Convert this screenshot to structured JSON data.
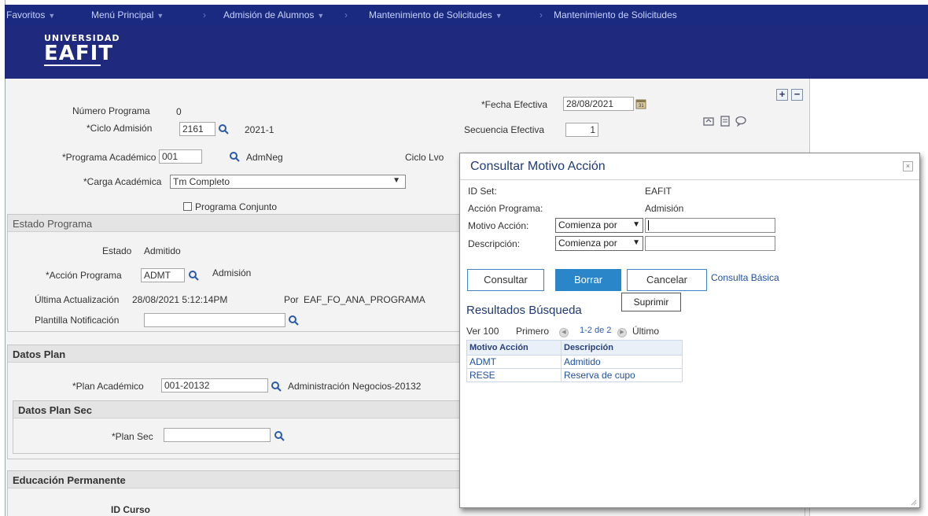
{
  "topnav": {
    "favoritos": "Favoritos",
    "menu": "Menú Principal",
    "crumb1": "Admisión de Alumnos",
    "crumb2": "Mantenimiento de Solicitudes",
    "crumb3": "Mantenimiento de Solicitudes"
  },
  "logo": {
    "line1": "UNIVERSIDAD",
    "line2": "EAFIT"
  },
  "form": {
    "numero_programa_label": "Número Programa",
    "numero_programa_value": "0",
    "ciclo_label": "*Ciclo Admisión",
    "ciclo_value": "2161",
    "ciclo_desc": "2021-1",
    "programa_label": "*Programa Académico",
    "programa_value": "001",
    "programa_desc": "AdmNeg",
    "ciclo_lvo_label": "Ciclo Lvo",
    "carga_label": "*Carga Académica",
    "carga_value": "Tm Completo",
    "programa_conjunto_label": "Programa Conjunto",
    "fecha_label": "*Fecha Efectiva",
    "fecha_value": "28/08/2021",
    "secuencia_label": "Secuencia Efectiva",
    "secuencia_value": "1"
  },
  "estado": {
    "title": "Estado Programa",
    "estado_label": "Estado",
    "estado_value": "Admitido",
    "accion_label": "*Acción Programa",
    "accion_value": "ADMT",
    "accion_desc": "Admisión",
    "ultima_label": "Última Actualización",
    "ultima_value": "28/08/2021  5:12:14PM",
    "por_label": "Por",
    "por_value": "EAF_FO_ANA_PROGRAMA",
    "plantilla_label": "Plantilla Notificación"
  },
  "plan": {
    "title": "Datos Plan",
    "plan_label": "*Plan Académico",
    "plan_value": "001-20132",
    "plan_desc": "Administración Negocios-20132",
    "sec_title": "Datos Plan Sec",
    "plan_sec_label": "*Plan Sec"
  },
  "educacion": {
    "title": "Educación Permanente",
    "id_curso_label": "ID Curso"
  },
  "modal": {
    "title": "Consultar Motivo Acción",
    "close": "×",
    "idset_label": "ID Set:",
    "idset_value": "EAFIT",
    "accion_label": "Acción Programa:",
    "accion_value": "Admisión",
    "motivo_label": "Motivo Acción:",
    "motivo_op": "Comienza por",
    "desc_label": "Descripción:",
    "desc_op": "Comienza por",
    "btn_consultar": "Consultar",
    "btn_borrar": "Borrar",
    "btn_cancelar": "Cancelar",
    "link_basica": "Consulta Básica",
    "tooltip": "Suprimir",
    "results_title": "Resultados Búsqueda",
    "pager_ver": "Ver 100",
    "pager_primero": "Primero",
    "pager_range": "1-2 de 2",
    "pager_ultimo": "Último",
    "col_motivo": "Motivo Acción",
    "col_desc": "Descripción",
    "rows": [
      {
        "motivo": "ADMT",
        "desc": "Admitido"
      },
      {
        "motivo": "RESE",
        "desc": "Reserva de cupo"
      }
    ]
  }
}
